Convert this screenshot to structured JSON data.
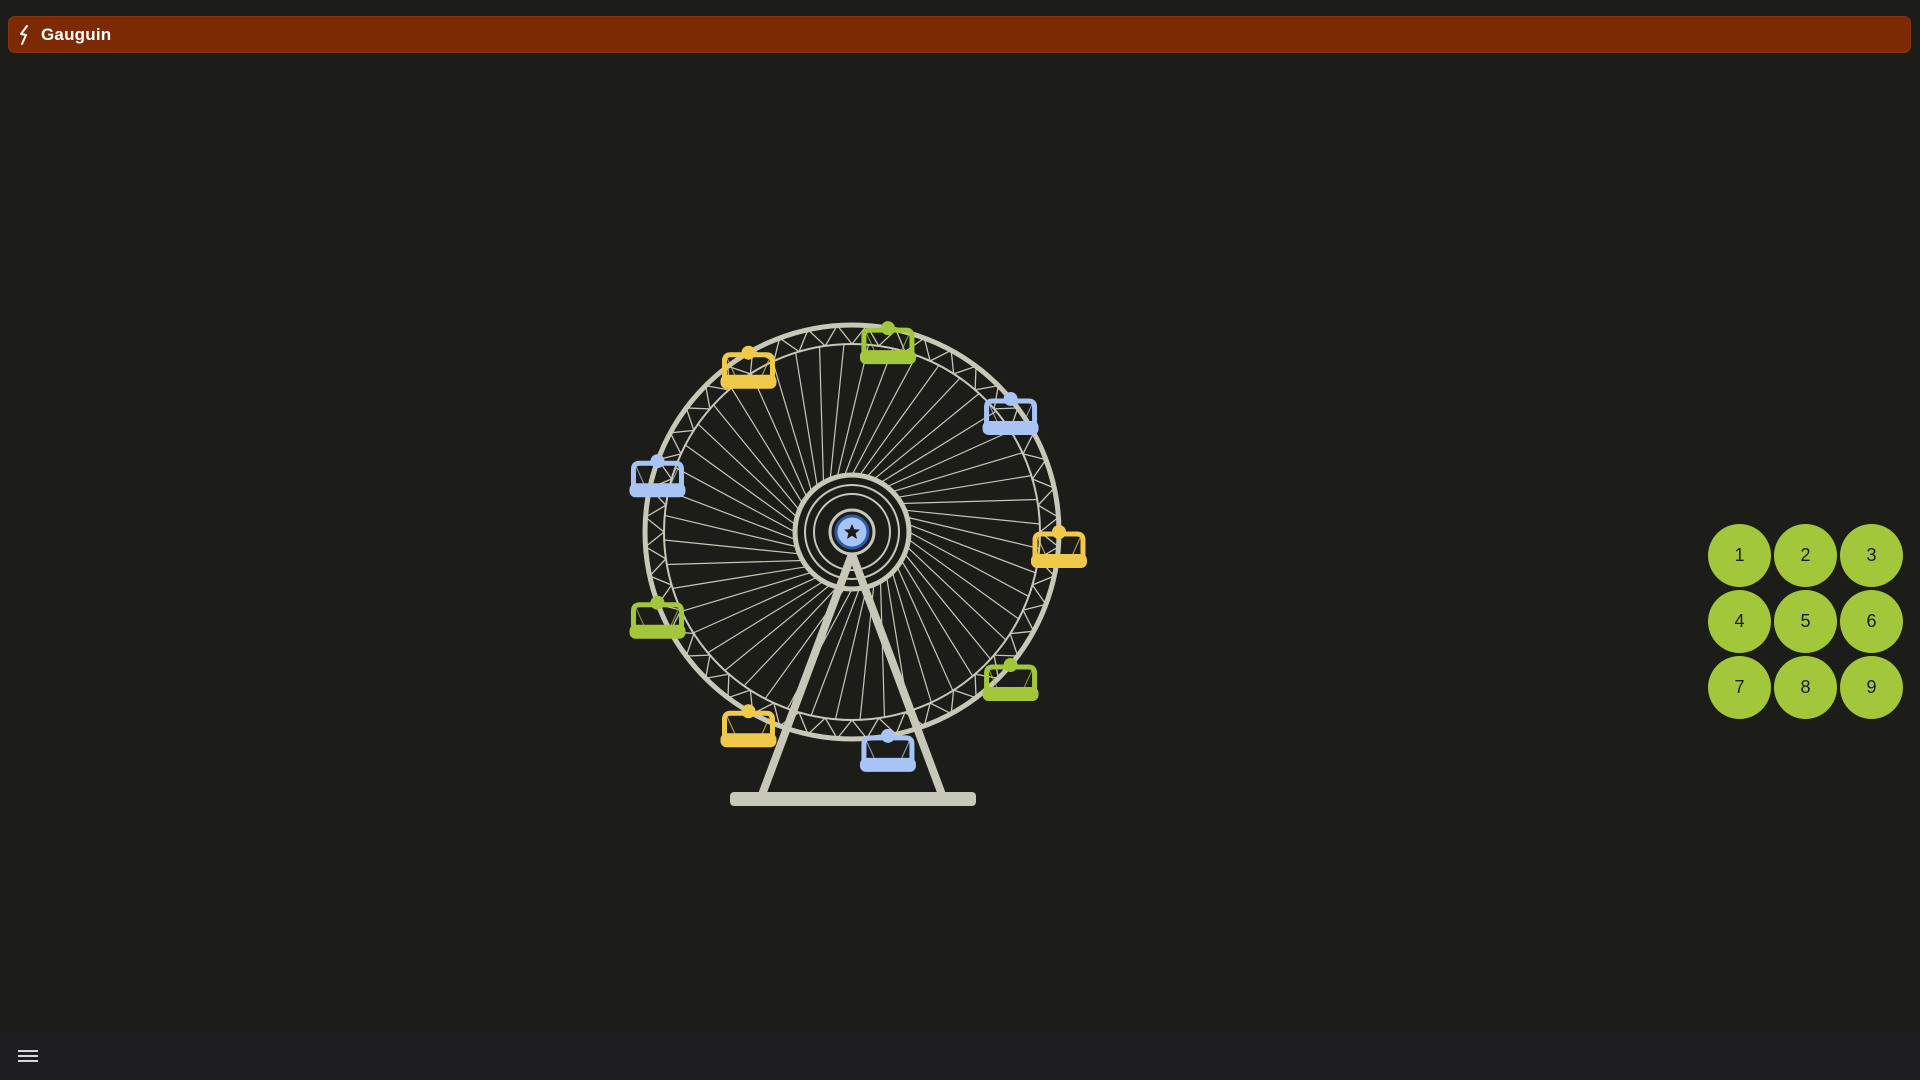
{
  "app": {
    "title": "Gauguin",
    "logo_icon": "lightning-icon"
  },
  "colors": {
    "title_bar": "#7b2a04",
    "background": "#1c1c19",
    "wheel": "#c8c8b8",
    "key": "#a2c73a",
    "gondola_yellow": "#f0c94a",
    "gondola_green": "#a2c73a",
    "gondola_blue": "#a8c4f5",
    "hub": "#4a86e8"
  },
  "illustration": {
    "name": "ferris-wheel",
    "hub_icon": "star-icon",
    "gondolas": [
      {
        "color": "green"
      },
      {
        "color": "blue"
      },
      {
        "color": "yellow"
      },
      {
        "color": "green"
      },
      {
        "color": "blue"
      },
      {
        "color": "yellow"
      },
      {
        "color": "green"
      },
      {
        "color": "blue"
      },
      {
        "color": "yellow"
      }
    ]
  },
  "keypad": {
    "keys": [
      "1",
      "2",
      "3",
      "4",
      "5",
      "6",
      "7",
      "8",
      "9"
    ]
  },
  "bottom_bar": {
    "menu_icon": "hamburger-menu-icon"
  }
}
